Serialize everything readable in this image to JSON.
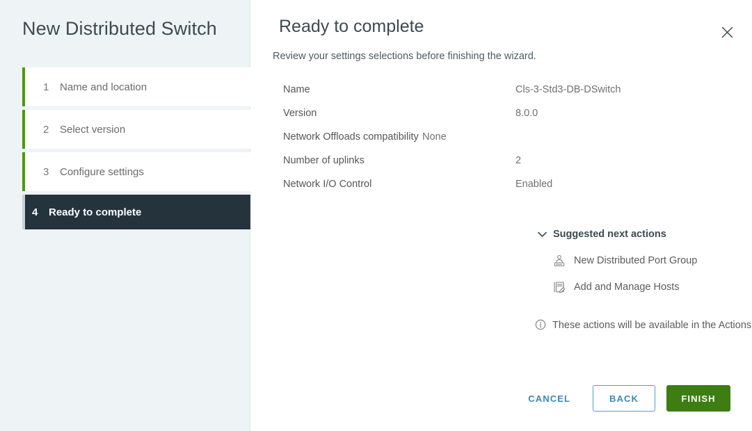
{
  "sidebar": {
    "title": "New Distributed Switch",
    "steps": [
      {
        "num": "1",
        "label": "Name and location",
        "state": "done"
      },
      {
        "num": "2",
        "label": "Select version",
        "state": "done"
      },
      {
        "num": "3",
        "label": "Configure settings",
        "state": "done"
      },
      {
        "num": "4",
        "label": "Ready to complete",
        "state": "current"
      }
    ]
  },
  "main": {
    "title": "Ready to complete",
    "subtitle": "Review your settings selections before finishing the wizard.",
    "close_icon": "close-icon"
  },
  "summary": [
    {
      "label": "Name",
      "value": "Cls-3-Std3-DB-DSwitch"
    },
    {
      "label": "Version",
      "value": "8.0.0"
    },
    {
      "label": "Network Offloads compatibility",
      "value": "None"
    },
    {
      "label": "Number of uplinks",
      "value": "2"
    },
    {
      "label": "Network I/O Control",
      "value": "Enabled"
    }
  ],
  "suggested": {
    "title": "Suggested next actions",
    "expanded": true,
    "chevron_icon": "chevron-down-icon",
    "actions": [
      {
        "label": "New Distributed Port Group",
        "icon": "port-group-icon"
      },
      {
        "label": "Add and Manage Hosts",
        "icon": "add-manage-hosts-icon"
      }
    ],
    "note_icon": "info-circle-icon",
    "note": "These actions will be available in the Actions menu of the new distributed switch."
  },
  "footer": {
    "cancel_label": "CANCEL",
    "back_label": "BACK",
    "finish_label": "FINISH"
  },
  "colors": {
    "accent_blue": "#3b88b5",
    "finish_green": "#3d7d11",
    "step_done_rail": "#4e9a06",
    "step_current_bg": "#25333d",
    "sidebar_bg": "#eef3f6"
  }
}
